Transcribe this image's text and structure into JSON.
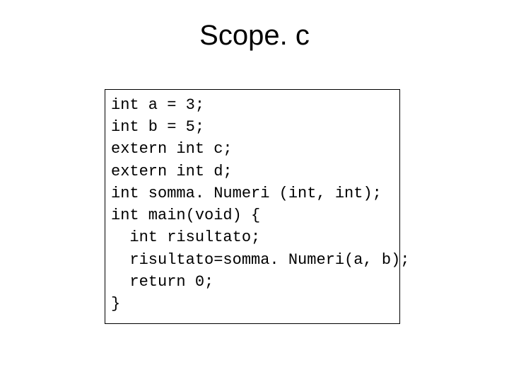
{
  "title": "Scope. c",
  "code": "int a = 3;\nint b = 5;\nextern int c;\nextern int d;\nint somma. Numeri (int, int);\nint main(void) {\n  int risultato;\n  risultato=somma. Numeri(a, b);\n  return 0;\n}"
}
